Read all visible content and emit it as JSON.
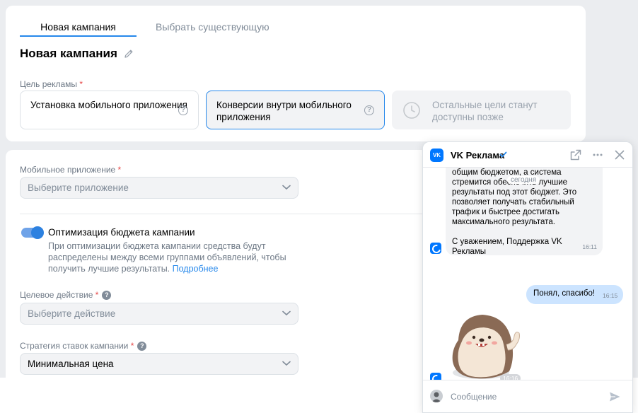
{
  "tabs": {
    "active": "Новая кампания",
    "inactive": "Выбрать существующую"
  },
  "campaign": {
    "title": "Новая кампания"
  },
  "goals": {
    "label": "Цель рекламы",
    "required_mark": "*",
    "items": [
      {
        "label": "Установка мобильного приложения",
        "help": "?"
      },
      {
        "label": "Конверсии внутри мобильного приложения",
        "help": "?"
      },
      {
        "label": "Остальные цели станут доступны позже"
      }
    ]
  },
  "mobile_app": {
    "label": "Мобильное приложение",
    "placeholder": "Выберите приложение"
  },
  "budget_opt": {
    "title": "Оптимизация бюджета кампании",
    "enabled": true,
    "desc": "При оптимизации бюджета кампании средства будут распределены между всеми группами объявлений, чтобы получить лучшие результаты.",
    "link": "Подробнее"
  },
  "target_action": {
    "label": "Целевое действие",
    "help": "?",
    "placeholder": "Выберите действие"
  },
  "bid_strategy": {
    "label": "Стратегия ставок кампании",
    "help": "?",
    "value": "Минимальная цена"
  },
  "chat": {
    "name": "VK Реклама",
    "logo_text": "VK",
    "date_chip": "сегодня",
    "incoming_text": "общим бюджетом, а система\nстремится обеспечить лучшие\nрезультаты под этот бюджет. Это\nпозволяет получать стабильный\nтрафик и быстрее достигать\nмаксимального результата.\n\nС уважением, Поддержка VK\nРекламы",
    "incoming_time": "16:11",
    "outgoing_text": "Понял, спасибо!",
    "outgoing_time": "16:15",
    "sticker_time": "16:16",
    "input_placeholder": "Сообщение"
  },
  "colors": {
    "accent": "#2688eb",
    "required": "#e64646",
    "outgoing_bubble": "#cce4ff"
  }
}
